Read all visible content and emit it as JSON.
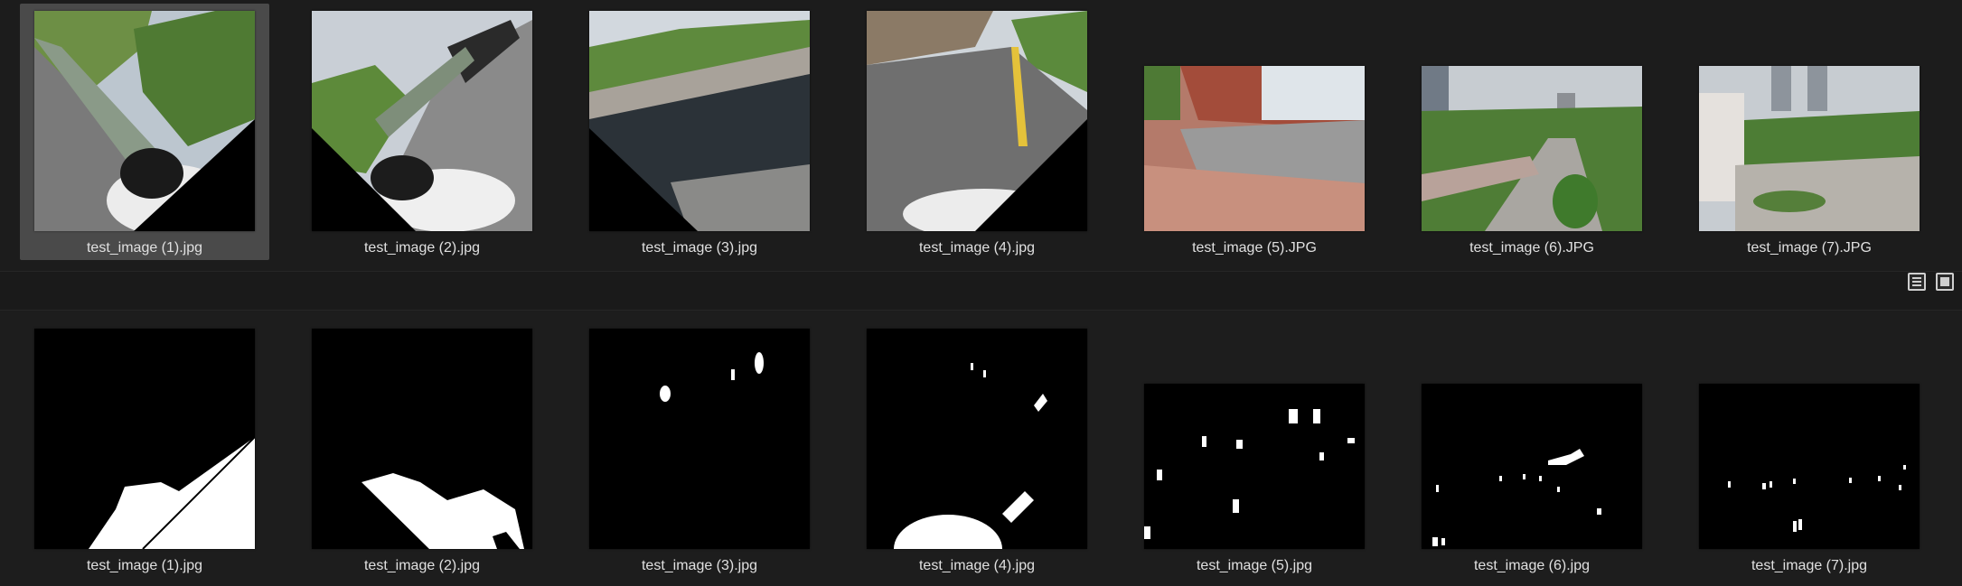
{
  "source_images": [
    {
      "filename": "test_image (1).jpg",
      "selected": true,
      "scene": "tilted-road-trees"
    },
    {
      "filename": "test_image (2).jpg",
      "selected": false,
      "scene": "tilted-road-car"
    },
    {
      "filename": "test_image (3).jpg",
      "selected": false,
      "scene": "plaza-water"
    },
    {
      "filename": "test_image (4).jpg",
      "selected": false,
      "scene": "road-yellow-line"
    },
    {
      "filename": "test_image (5).JPG",
      "selected": false,
      "scene": "building-steps"
    },
    {
      "filename": "test_image (6).JPG",
      "selected": false,
      "scene": "campus-aerial"
    },
    {
      "filename": "test_image (7).JPG",
      "selected": false,
      "scene": "campus-aerial-2"
    }
  ],
  "mask_images": [
    {
      "filename": "test_image (1).jpg"
    },
    {
      "filename": "test_image (2).jpg"
    },
    {
      "filename": "test_image (3).jpg"
    },
    {
      "filename": "test_image (4).jpg"
    },
    {
      "filename": "test_image (5).jpg"
    },
    {
      "filename": "test_image (6).jpg"
    },
    {
      "filename": "test_image (7).jpg"
    }
  ],
  "view_toggle": {
    "list_icon": "list-view-icon",
    "grid_icon": "thumbnail-view-icon"
  },
  "colors": {
    "background": "#1b1b1b",
    "selection": "#4a4a4a",
    "caption": "#e0e0e0"
  }
}
